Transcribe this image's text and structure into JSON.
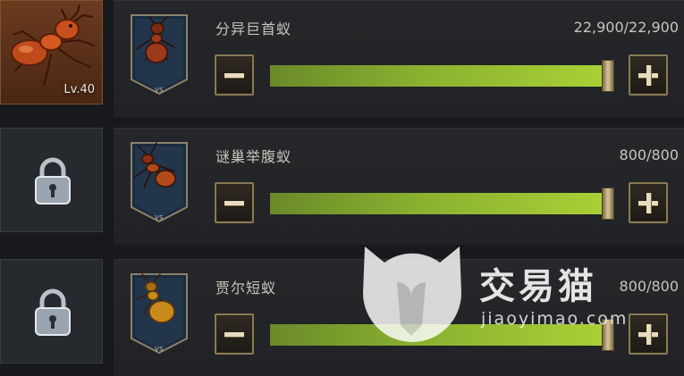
{
  "rows": [
    {
      "leader": {
        "state": "unlocked",
        "level_label": "Lv.40",
        "icon": "fire-ant-icon"
      },
      "unit": {
        "name": "分异巨首蚁",
        "count": "22,900/22,900",
        "card_tag": "VS",
        "fill_fraction": 1.0,
        "ant_color": "#9a3a1a"
      },
      "controls": {
        "minus_label": "−",
        "plus_label": "+"
      }
    },
    {
      "leader": {
        "state": "locked",
        "icon": "padlock-icon"
      },
      "unit": {
        "name": "谜巢举腹蚁",
        "count": "800/800",
        "card_tag": "VS",
        "fill_fraction": 1.0,
        "ant_color": "#b24a18"
      },
      "controls": {
        "minus_label": "−",
        "plus_label": "+"
      }
    },
    {
      "leader": {
        "state": "locked",
        "icon": "padlock-icon"
      },
      "unit": {
        "name": "贾尔短蚁",
        "count": "800/800",
        "card_tag": "VS",
        "fill_fraction": 1.0,
        "ant_color": "#c98a1c"
      },
      "controls": {
        "minus_label": "−",
        "plus_label": "+"
      }
    }
  ],
  "watermark": {
    "title": "交易猫",
    "url": "jiaoyimao.com",
    "icon": "cat-logo-icon"
  },
  "colors": {
    "fill_start": "#6a8a2a",
    "fill_end": "#a9cf36",
    "frame_gold": "#8a7a55"
  }
}
